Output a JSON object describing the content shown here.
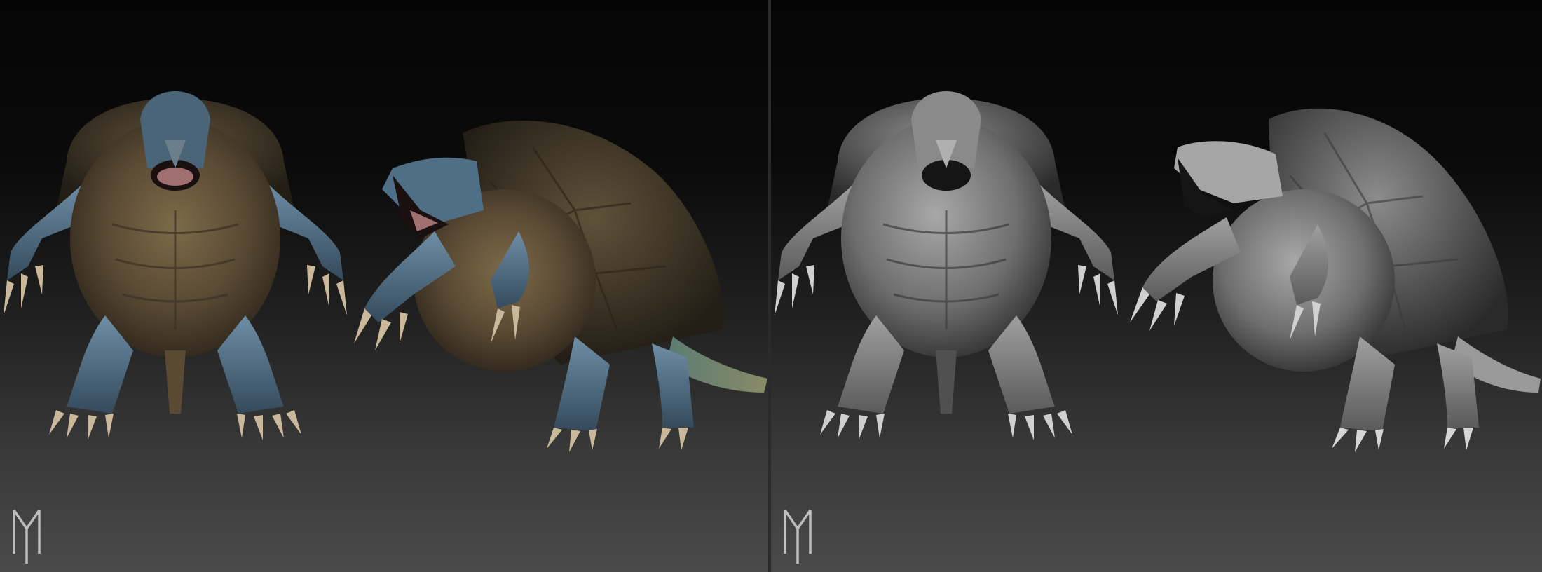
{
  "scene": {
    "description_color_left": "#6b6040",
    "accent_blue": "#4f6f86",
    "shell_brown": "#4a3f2c",
    "clay_gray": "#8a8a8a",
    "background_top": "#050505",
    "background_bottom": "#4a4a4a"
  },
  "panels": [
    {
      "id": "textured",
      "views": [
        "front",
        "three-quarter"
      ]
    },
    {
      "id": "clay",
      "views": [
        "front",
        "three-quarter"
      ]
    }
  ],
  "logo": {
    "icon": "monogram-m-icon"
  }
}
